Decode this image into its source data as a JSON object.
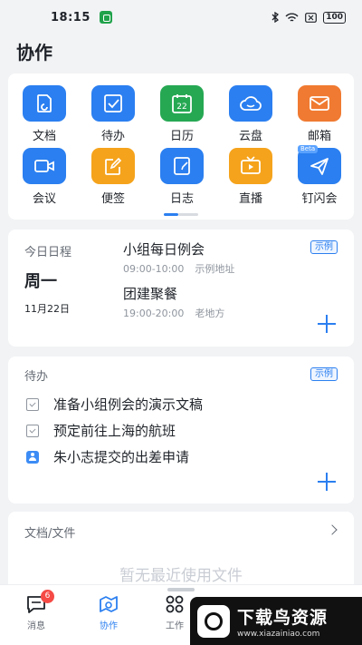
{
  "status": {
    "time": "18:15",
    "battery": "100"
  },
  "page_title": "协作",
  "apps": [
    {
      "label": "文档",
      "icon": "doc-icon",
      "color": "#2b7ff0"
    },
    {
      "label": "待办",
      "icon": "todo-check-icon",
      "color": "#2b7ff0"
    },
    {
      "label": "日历",
      "icon": "calendar-icon",
      "color": "#26a853",
      "badge": "22"
    },
    {
      "label": "云盘",
      "icon": "cloud-icon",
      "color": "#2b7ff0"
    },
    {
      "label": "邮箱",
      "icon": "mail-icon",
      "color": "#f07a31"
    },
    {
      "label": "会议",
      "icon": "video-camera-icon",
      "color": "#2b7ff0"
    },
    {
      "label": "便签",
      "icon": "note-pencil-icon",
      "color": "#f5a31c"
    },
    {
      "label": "日志",
      "icon": "journal-icon",
      "color": "#2b7ff0"
    },
    {
      "label": "直播",
      "icon": "tv-live-icon",
      "color": "#f5a31c"
    },
    {
      "label": "钉闪会",
      "icon": "flash-meeting-icon",
      "color": "#2b7ff0",
      "tag": "Beta"
    }
  ],
  "schedule": {
    "caption": "今日日程",
    "weekday": "周一",
    "date": "11月22日",
    "tag": "示例",
    "events": [
      {
        "title": "小组每日例会",
        "time": "09:00-10:00",
        "place": "示例地址"
      },
      {
        "title": "团建聚餐",
        "time": "19:00-20:00",
        "place": "老地方"
      }
    ]
  },
  "todo": {
    "caption": "待办",
    "tag": "示例",
    "items": [
      {
        "text": "准备小组例会的演示文稿",
        "icon": "checkbox-icon"
      },
      {
        "text": "预定前往上海的航班",
        "icon": "checkbox-icon"
      },
      {
        "text": "朱小志提交的出差申请",
        "icon": "approval-person-icon"
      }
    ]
  },
  "docs": {
    "caption": "文档/文件",
    "empty": "暂无最近使用文件"
  },
  "tabbar": {
    "messages": {
      "label": "消息",
      "badge": "6"
    },
    "collab": {
      "label": "协作"
    },
    "work": {
      "label": "工作"
    }
  },
  "watermark": {
    "title": "下载鸟资源",
    "url": "www.xiazainiao.com"
  },
  "colors": {
    "accent": "#2b7ff0",
    "badge": "#f54a45"
  }
}
